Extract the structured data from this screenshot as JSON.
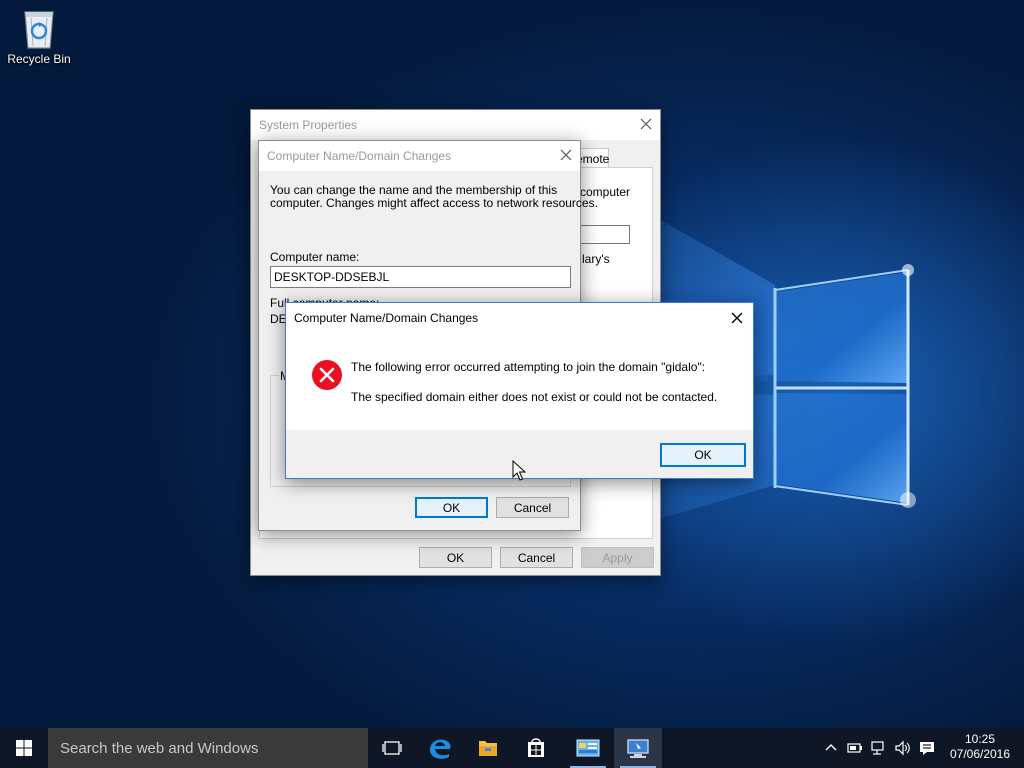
{
  "desktop": {
    "icons": [
      {
        "label": "Recycle Bin",
        "icon": "recycle-bin-icon"
      }
    ]
  },
  "system_properties": {
    "title": "System Properties",
    "tab_fragment": "emote",
    "desc_fragment": "computer",
    "field_fragment": "lary's",
    "buttons": {
      "ok": "OK",
      "cancel": "Cancel",
      "apply": "Apply"
    }
  },
  "name_changes": {
    "title": "Computer Name/Domain Changes",
    "description_line1": "You can change the name and the membership of this",
    "description_line2": "computer. Changes might affect access to network resources.",
    "computer_name_label": "Computer name:",
    "computer_name_value": "DESKTOP-DDSEBJL",
    "full_name_label": "Full computer name:",
    "full_name_fragment": "DE",
    "member_of_fragment": "M",
    "buttons": {
      "ok": "OK",
      "cancel": "Cancel"
    }
  },
  "error_dialog": {
    "title": "Computer Name/Domain Changes",
    "icon": "error-icon",
    "message_line1": "The following error occurred attempting to join the domain \"gidalo\":",
    "message_line2": "The specified domain either does not exist or could not be contacted.",
    "ok_label": "OK"
  },
  "taskbar": {
    "search_placeholder": "Search the web and Windows",
    "apps": [
      "task-view-icon",
      "edge-icon",
      "file-explorer-icon",
      "store-icon",
      "control-panel-icon",
      "system-properties-icon"
    ],
    "tray_icons": [
      "show-hidden-icons-chevron-icon",
      "power-icon",
      "network-icon",
      "volume-icon",
      "action-center-icon"
    ],
    "time": "10:25",
    "date": "07/06/2016"
  },
  "colors": {
    "accent": "#0078d7",
    "error_red": "#e81123",
    "taskbar": "#0f1726",
    "desktop_blue": "#0b3f86"
  }
}
